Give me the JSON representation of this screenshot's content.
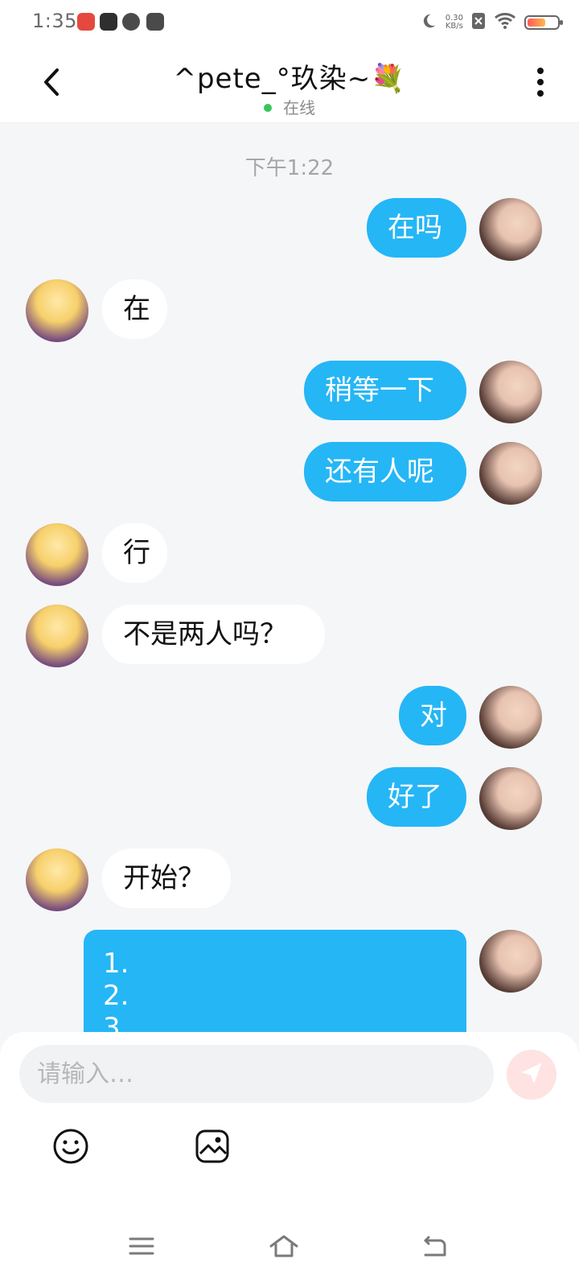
{
  "status_bar": {
    "time": "1:35",
    "net_speed": "0.30",
    "net_unit": "KB/s"
  },
  "header": {
    "title": "^pete_°玖染~💐",
    "status_text": "在线",
    "status_color": "#35c759"
  },
  "chat": {
    "timestamp": "下午1:22",
    "messages": [
      {
        "from": "me",
        "text": "在吗"
      },
      {
        "from": "them",
        "text": "在"
      },
      {
        "from": "me",
        "text": "稍等一下"
      },
      {
        "from": "me",
        "text": "还有人呢"
      },
      {
        "from": "them",
        "text": "行"
      },
      {
        "from": "them",
        "text": "不是两人吗？"
      },
      {
        "from": "me",
        "text": "对"
      },
      {
        "from": "me",
        "text": "好了"
      },
      {
        "from": "them",
        "text": "开始？"
      },
      {
        "from": "me",
        "lines": [
          "1.",
          "2.",
          "3."
        ]
      }
    ]
  },
  "composer": {
    "placeholder": "请输入…",
    "send_icon": "send-icon",
    "tools": [
      "emoji-icon",
      "image-icon"
    ]
  },
  "colors": {
    "accent_blue": "#25b6f6",
    "bubble_white": "#ffffff",
    "background": "#f5f6f8",
    "send_button": "#ffe2e2"
  }
}
